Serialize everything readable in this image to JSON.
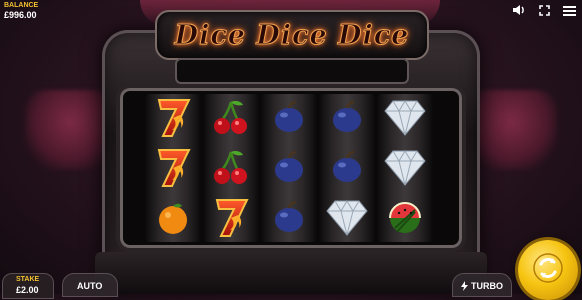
{
  "game": {
    "title": "Dice Dice Dice"
  },
  "hud": {
    "balance_label": "BALANCE",
    "balance_value": "£996.00",
    "stake_label": "STAKE",
    "stake_value": "£2.00",
    "auto_label": "AUTO",
    "turbo_label": "TURBO",
    "icons": [
      "sound-icon",
      "fullscreen-icon",
      "menu-icon"
    ]
  },
  "reels": [
    [
      "seven",
      "seven",
      "orange"
    ],
    [
      "cherry",
      "cherry",
      "seven"
    ],
    [
      "plum",
      "plum",
      "plum"
    ],
    [
      "plum",
      "plum",
      "diamond"
    ],
    [
      "diamond",
      "diamond",
      "watermelon"
    ]
  ],
  "colors": {
    "accent": "#f2c230",
    "spin_button": "#f6c411"
  }
}
